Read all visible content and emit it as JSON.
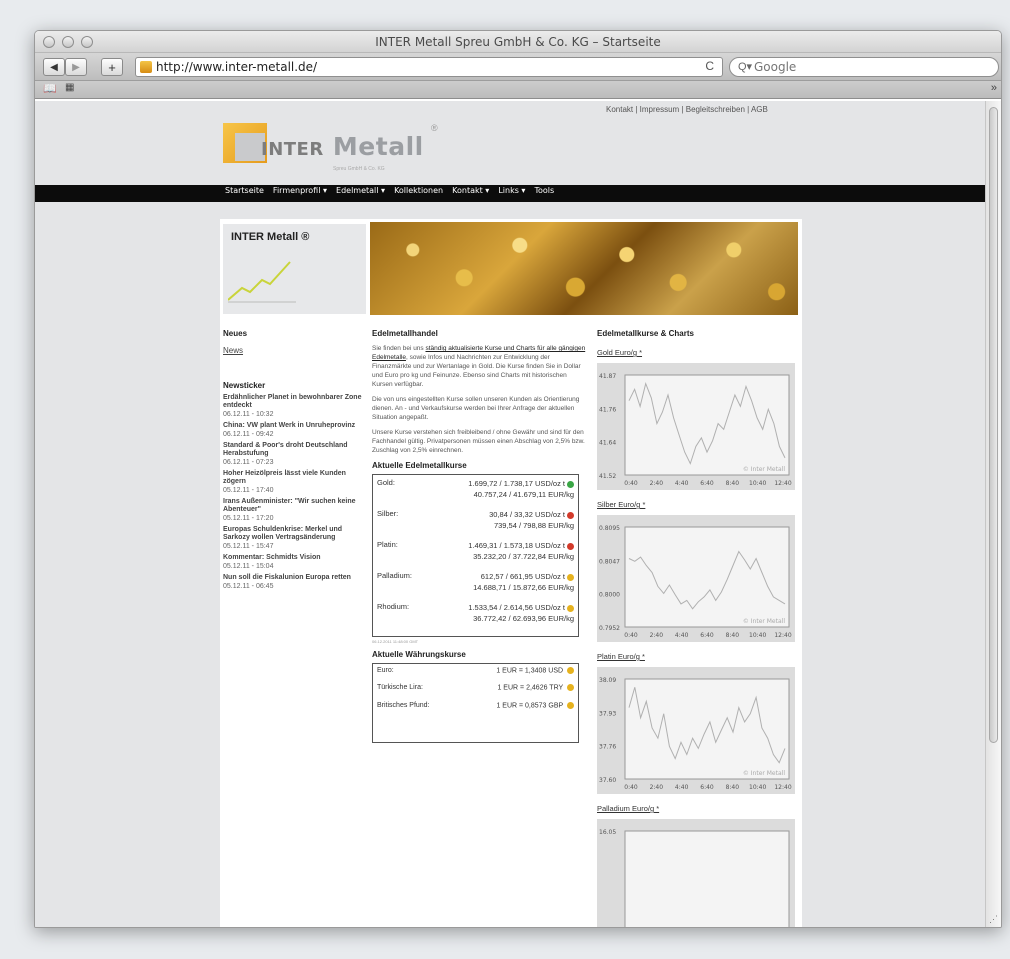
{
  "browser": {
    "title": "INTER Metall Spreu GmbH & Co. KG – Startseite",
    "url": "http://www.inter-metall.de/",
    "search_placeholder": "Google",
    "back": "◀",
    "forward": "▶",
    "add": "+",
    "reload": "C",
    "overflow": "»"
  },
  "site": {
    "toplinks": "Kontakt | Impressum | Begleitschreiben | AGB",
    "logo": {
      "text_first": "INTER",
      "text_second": "Metall",
      "reg": "®",
      "sub": "Spreu GmbH & Co. KG"
    },
    "nav": [
      "Startseite",
      "Firmenprofil",
      "Edelmetall",
      "Kollektionen",
      "Kontakt",
      "Links",
      "Tools"
    ],
    "tile_title": "INTER Metall ®"
  },
  "left": {
    "heading": "Neues",
    "news_link": "News",
    "ticker_heading": "Newsticker",
    "items": [
      {
        "title": "Erdähnlicher Planet in bewohnbarer Zone entdeckt",
        "date": "06.12.11 - 10:32"
      },
      {
        "title": "China: VW plant Werk in Unruheprovinz",
        "date": "06.12.11 - 09:42"
      },
      {
        "title": "Standard & Poor's droht Deutschland Herabstufung",
        "date": "06.12.11 - 07:23"
      },
      {
        "title": "Hoher Heizölpreis lässt viele Kunden zögern",
        "date": "05.12.11 - 17:40"
      },
      {
        "title": "Irans Außenminister: \"Wir suchen keine Abenteuer\"",
        "date": "05.12.11 - 17:20"
      },
      {
        "title": "Europas Schuldenkrise: Merkel und Sarkozy wollen Vertragsänderung",
        "date": "05.12.11 - 15:47"
      },
      {
        "title": "Kommentar: Schmidts Vision",
        "date": "05.12.11 - 15:04"
      },
      {
        "title": "Nun soll die Fiskalunion Europa retten",
        "date": "05.12.11 - 06:45"
      }
    ]
  },
  "mid": {
    "heading": "Edelmetallhandel",
    "para1_pre": "Sie finden bei uns ",
    "para1_link": "ständig aktualisierte Kurse und Charts für alle gängigen Edelmetalle",
    "para1_post": ", sowie Infos und Nachrichten zur Entwicklung der Finanzmärkte und zur Wertanlage in Gold. Die Kurse finden Sie in Dollar und Euro pro kg und Feinunze. Ebenso sind Charts mit historischen Kursen verfügbar.",
    "para2": "Die von uns eingestellten Kurse sollen unseren Kunden als Orientierung dienen. An - und Verkaufskurse werden bei Ihrer Anfrage der aktuellen Situation angepaßt.",
    "para3": "Unsere Kurse verstehen sich freibleibend / ohne Gewähr und sind für den Fachhandel gültig. Privatpersonen müssen einen Abschlag von 2,5% bzw. Zuschlag von 2,5% einrechnen.",
    "prices_heading": "Aktuelle Edelmetallkurse",
    "prices": [
      {
        "label": "Gold:",
        "line1": "1.699,72 / 1.738,17 USD/oz t",
        "line2": "40.757,24 / 41.679,11 EUR/kg",
        "trend": "green"
      },
      {
        "label": "Silber:",
        "line1": "30,84 / 33,32 USD/oz t",
        "line2": "739,54 / 798,88 EUR/kg",
        "trend": "red"
      },
      {
        "label": "Platin:",
        "line1": "1.469,31 / 1.573,18 USD/oz t",
        "line2": "35.232,20 / 37.722,84 EUR/kg",
        "trend": "red"
      },
      {
        "label": "Palladium:",
        "line1": "612,57 / 661,95 USD/oz t",
        "line2": "14.688,71 / 15.872,66 EUR/kg",
        "trend": "yellow"
      },
      {
        "label": "Rhodium:",
        "line1": "1.533,54 / 2.614,56 USD/oz t",
        "line2": "36.772,42 / 62.693,96 EUR/kg",
        "trend": "yellow"
      }
    ],
    "stamp": "06.12.2011 11:48:00 GMT",
    "currency_heading": "Aktuelle Währungskurse",
    "currencies": [
      {
        "label": "Euro:",
        "value": "1 EUR = 1,3408 USD"
      },
      {
        "label": "Türkische Lira:",
        "value": "1 EUR = 2,4626 TRY"
      },
      {
        "label": "Britisches Pfund:",
        "value": "1 EUR = 0,8573 GBP"
      }
    ]
  },
  "right": {
    "heading": "Edelmetallkurse & Charts",
    "charts": [
      {
        "title": "Gold Euro/g *",
        "yticks": [
          "41.87",
          "41.76",
          "41.64",
          "41.52"
        ],
        "xticks": [
          "0:40",
          "2:40",
          "4:40",
          "6:40",
          "8:40",
          "10:40",
          "12:40"
        ],
        "watermark": "© Inter Metall",
        "series": [
          41.78,
          41.82,
          41.76,
          41.84,
          41.79,
          41.7,
          41.74,
          41.8,
          41.72,
          41.66,
          41.6,
          41.56,
          41.62,
          41.65,
          41.6,
          41.64,
          41.7,
          41.68,
          41.74,
          41.8,
          41.76,
          41.83,
          41.78,
          41.72,
          41.68,
          41.75,
          41.7,
          41.62,
          41.58
        ]
      },
      {
        "title": "Silber Euro/g *",
        "yticks": [
          "0.8095",
          "0.8047",
          "0.8000",
          "0.7952"
        ],
        "xticks": [
          "0:40",
          "2:40",
          "4:40",
          "6:40",
          "8:40",
          "10:40",
          "12:40"
        ],
        "watermark": "© Inter Metall",
        "series": [
          0.805,
          0.8046,
          0.8052,
          0.804,
          0.803,
          0.801,
          0.8,
          0.8012,
          0.7998,
          0.7985,
          0.799,
          0.7978,
          0.7988,
          0.7995,
          0.8005,
          0.799,
          0.8002,
          0.802,
          0.804,
          0.806,
          0.8048,
          0.8035,
          0.805,
          0.803,
          0.801,
          0.7995,
          0.799,
          0.7985
        ]
      },
      {
        "title": "Platin Euro/g *",
        "yticks": [
          "38.09",
          "37.93",
          "37.76",
          "37.60"
        ],
        "xticks": [
          "0:40",
          "2:40",
          "4:40",
          "6:40",
          "8:40",
          "10:40",
          "12:40"
        ],
        "watermark": "© Inter Metall",
        "series": [
          37.95,
          38.05,
          37.9,
          37.98,
          37.85,
          37.8,
          37.92,
          37.76,
          37.7,
          37.78,
          37.72,
          37.8,
          37.75,
          37.82,
          37.88,
          37.78,
          37.84,
          37.9,
          37.83,
          37.95,
          37.88,
          37.92,
          38.0,
          37.85,
          37.8,
          37.72,
          37.68,
          37.75
        ]
      },
      {
        "title": "Palladium Euro/g *",
        "yticks": [
          "16.05"
        ],
        "xticks": [],
        "watermark": "",
        "series": []
      }
    ]
  }
}
